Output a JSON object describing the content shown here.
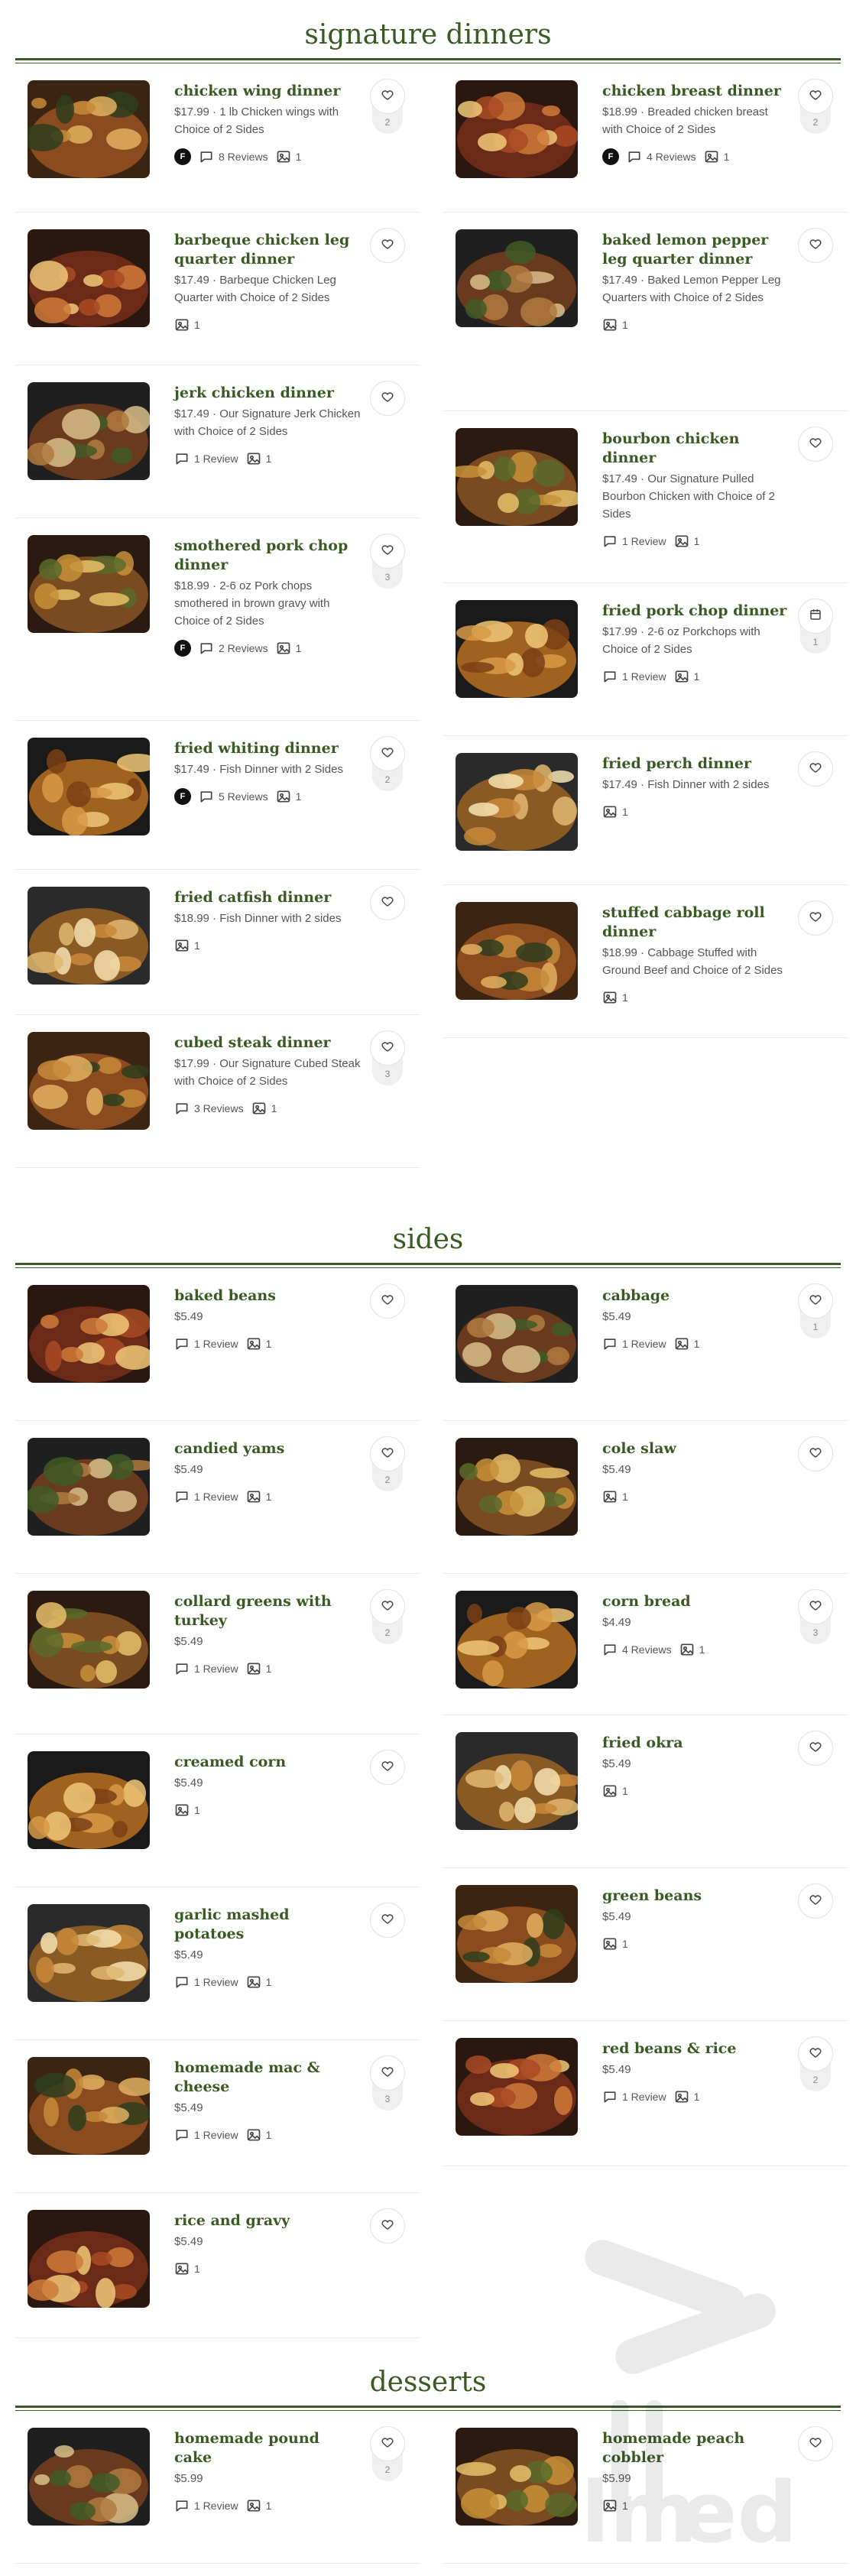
{
  "sections": {
    "dinners": {
      "title": "signature dinners",
      "left": [
        {
          "name": "chicken wing dinner",
          "desc": "$17.99 · 1 lb Chicken wings with Choice of 2 Sides",
          "badge": "F",
          "reviews": "8 Reviews",
          "photos": "1",
          "fav": "2",
          "fav_icon": "heart-icon"
        },
        {
          "name": "barbeque chicken leg quarter dinner",
          "desc": "$17.49 · Barbeque Chicken Leg Quarter with Choice of 2 Sides",
          "photos": "1",
          "fav_icon": "heart-icon"
        },
        {
          "name": "jerk chicken dinner",
          "desc": "$17.49 · Our Signature Jerk Chicken with Choice of 2 Sides",
          "reviews": "1 Review",
          "photos": "1",
          "fav_icon": "heart-icon"
        },
        {
          "name": "smothered pork chop dinner",
          "desc": "$18.99 · 2-6 oz Pork chops smothered in brown gravy with Choice of 2 Sides",
          "badge": "F",
          "reviews": "2 Reviews",
          "photos": "1",
          "fav": "3",
          "fav_icon": "heart-icon"
        },
        {
          "name": "fried whiting dinner",
          "desc": "$17.49 · Fish Dinner with 2 Sides",
          "badge": "F",
          "reviews": "5 Reviews",
          "photos": "1",
          "fav": "2",
          "fav_icon": "heart-icon"
        },
        {
          "name": "fried catfish dinner",
          "desc": "$18.99 · Fish Dinner with 2 sides",
          "photos": "1",
          "fav_icon": "heart-icon"
        },
        {
          "name": "cubed steak dinner",
          "desc": "$17.99 · Our Signature Cubed Steak with Choice of 2 Sides",
          "reviews": "3 Reviews",
          "photos": "1",
          "fav": "3",
          "fav_icon": "heart-icon"
        }
      ],
      "right": [
        {
          "name": "chicken breast dinner",
          "desc": "$18.99 · Breaded chicken breast with Choice of 2 Sides",
          "badge": "F",
          "reviews": "4 Reviews",
          "photos": "1",
          "fav": "2",
          "fav_icon": "heart-icon"
        },
        {
          "name": "baked lemon pepper leg quarter dinner",
          "desc": "$17.49 · Baked Lemon Pepper Leg Quarters with Choice of 2 Sides",
          "photos": "1",
          "fav_icon": "heart-icon"
        },
        {
          "name": "bourbon chicken dinner",
          "desc": "$17.49 · Our Signature Pulled Bourbon Chicken with Choice of 2 Sides",
          "reviews": "1 Review",
          "photos": "1",
          "fav_icon": "heart-icon"
        },
        {
          "name": "fried pork chop dinner",
          "desc": "$17.99 · 2-6 oz Porkchops with Choice of 2 Sides",
          "reviews": "1 Review",
          "photos": "1",
          "fav": "1",
          "fav_icon": "calendar-icon"
        },
        {
          "name": "fried perch dinner",
          "desc": "$17.49 · Fish Dinner with 2 sides",
          "photos": "1",
          "fav_icon": "heart-icon"
        },
        {
          "name": "stuffed cabbage roll dinner",
          "desc": "$18.99 · Cabbage Stuffed with Ground Beef and Choice of 2 Sides",
          "photos": "1",
          "fav_icon": "heart-icon"
        }
      ]
    },
    "sides": {
      "title": "sides",
      "left": [
        {
          "name": "baked beans",
          "desc": "$5.49",
          "reviews": "1 Review",
          "photos": "1",
          "fav_icon": "heart-icon"
        },
        {
          "name": "candied yams",
          "desc": "$5.49",
          "reviews": "1 Review",
          "photos": "1",
          "fav": "2",
          "fav_icon": "heart-icon"
        },
        {
          "name": "collard greens with turkey",
          "desc": "$5.49",
          "reviews": "1 Review",
          "photos": "1",
          "fav": "2",
          "fav_icon": "heart-icon"
        },
        {
          "name": "creamed corn",
          "desc": "$5.49",
          "photos": "1",
          "fav_icon": "heart-icon"
        },
        {
          "name": "garlic mashed potatoes",
          "desc": "$5.49",
          "reviews": "1 Review",
          "photos": "1",
          "fav_icon": "heart-icon"
        },
        {
          "name": "homemade mac & cheese",
          "desc": "$5.49",
          "reviews": "1 Review",
          "photos": "1",
          "fav": "3",
          "fav_icon": "heart-icon"
        },
        {
          "name": "rice and gravy",
          "desc": "$5.49",
          "photos": "1",
          "fav_icon": "heart-icon"
        }
      ],
      "right": [
        {
          "name": "cabbage",
          "desc": "$5.49",
          "reviews": "1 Review",
          "photos": "1",
          "fav": "1",
          "fav_icon": "heart-icon"
        },
        {
          "name": "cole slaw",
          "desc": "$5.49",
          "photos": "1",
          "fav_icon": "heart-icon"
        },
        {
          "name": "corn bread",
          "desc": "$4.49",
          "reviews": "4 Reviews",
          "photos": "1",
          "fav": "3",
          "fav_icon": "heart-icon"
        },
        {
          "name": "fried okra",
          "desc": "$5.49",
          "photos": "1",
          "fav_icon": "heart-icon"
        },
        {
          "name": "green beans",
          "desc": "$5.49",
          "photos": "1",
          "fav_icon": "heart-icon"
        },
        {
          "name": "red beans & rice",
          "desc": "$5.49",
          "reviews": "1 Review",
          "photos": "1",
          "fav": "2",
          "fav_icon": "heart-icon"
        }
      ]
    },
    "desserts": {
      "title": "desserts",
      "left": [
        {
          "name": "homemade pound cake",
          "desc": "$5.99",
          "reviews": "1 Review",
          "photos": "1",
          "fav": "2",
          "fav_icon": "heart-icon"
        }
      ],
      "right": [
        {
          "name": "homemade peach cobbler",
          "desc": "$5.99",
          "photos": "1",
          "fav_icon": "heart-icon"
        }
      ]
    }
  },
  "watermark": {
    "text": "allmenus"
  },
  "colors": {
    "accent": "#3a5a23",
    "badge": "#111111",
    "muted": "#555555"
  }
}
